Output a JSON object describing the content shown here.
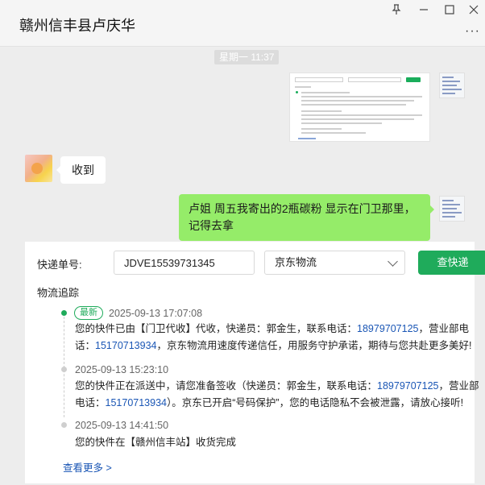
{
  "window": {
    "title": "赣州信丰县卢庆华",
    "pin_icon": "pin-icon",
    "minimize_icon": "minimize-icon",
    "maximize_icon": "maximize-icon",
    "close_icon": "close-icon",
    "more_icon": "more-dots-icon"
  },
  "chat": {
    "timestamp": "星期一 11:37",
    "incoming_message": "收到",
    "outgoing_message": "卢姐  周五我寄出的2瓶碳粉  显示在门卫那里，记得去拿"
  },
  "tracking": {
    "number_label": "快递单号:",
    "number_value": "JDVE15539731345",
    "carrier": "京东物流",
    "query_button": "查快递",
    "section_title": "物流追踪",
    "latest_badge": "最新",
    "events": [
      {
        "time": "2025-09-13 17:07:08",
        "text_a": "您的快件已由【门卫代收】代收，快递员：郭金生，联系电话：",
        "phone_1": "18979707125",
        "text_b": "，营业部电话：",
        "phone_2": "15170713934",
        "text_c": "，京东物流用速度传递信任，用服务守护承诺，期待与您共赴更多美好!"
      },
      {
        "time": "2025-09-13 15:23:10",
        "text_a": "您的快件正在派送中，请您准备签收（快递员：郭金生，联系电话：",
        "phone_1": "18979707125",
        "text_b": "，营业部电话：",
        "phone_2": "15170713934",
        "text_c": "）。京东已开启“号码保护”，您的电话隐私不会被泄露，请放心接听!"
      },
      {
        "time": "2025-09-13 14:41:50",
        "text_a": "您的快件在【赣州信丰站】收货完成"
      }
    ],
    "see_more": "查看更多 >"
  },
  "colors": {
    "accent_green": "#1fab5b",
    "bubble_green": "#95ec69",
    "phone_blue": "#1a56b5"
  }
}
